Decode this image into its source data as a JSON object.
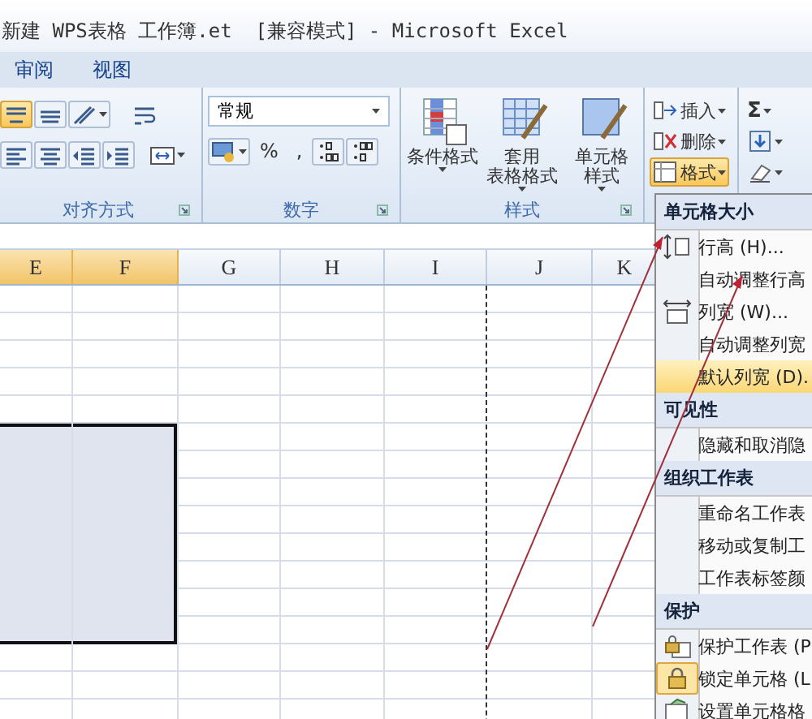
{
  "window": {
    "title": "新建 WPS表格 工作簿.et  [兼容模式] - Microsoft Excel"
  },
  "ribbon_tabs": [
    {
      "label": "审阅",
      "selected": false
    },
    {
      "label": "视图",
      "selected": false
    }
  ],
  "ribbon_groups": [
    {
      "kind": "alignment",
      "label": "对齐方式",
      "buttons": [
        {
          "kind": "top",
          "selected": true
        },
        {
          "kind": "middle",
          "selected": false
        },
        {
          "kind": "orientation",
          "selected": false
        },
        {
          "kind": "wrap",
          "selected": false
        },
        {
          "kind": "left",
          "selected": false
        },
        {
          "kind": "center",
          "selected": false
        },
        {
          "kind": "outdent",
          "selected": false
        },
        {
          "kind": "indent",
          "selected": false
        },
        {
          "kind": "merge",
          "selected": false
        }
      ]
    },
    {
      "kind": "number",
      "label": "数字",
      "format": "常规",
      "buttons": [
        "%",
        ","
      ]
    },
    {
      "kind": "styles",
      "label": "样式",
      "buttons": [
        {
          "kind": "conditional",
          "lines": [
            "条件格式"
          ]
        },
        {
          "kind": "table",
          "lines": [
            "套用",
            "表格格式"
          ]
        },
        {
          "kind": "cellstyle",
          "lines": [
            "单元格",
            "样式"
          ]
        }
      ]
    },
    {
      "kind": "cells",
      "buttons": [
        {
          "kind": "insert",
          "label": "插入",
          "selected": false
        },
        {
          "kind": "delete",
          "label": "删除",
          "selected": false
        },
        {
          "kind": "format",
          "label": "格式",
          "selected": true
        }
      ]
    },
    {
      "kind": "editing",
      "buttons": [
        {
          "kind": "sum",
          "label": "Σ"
        },
        {
          "kind": "fill"
        },
        {
          "kind": "clear"
        }
      ]
    }
  ],
  "sheet": {
    "columns": [
      {
        "label": "E",
        "selected": true,
        "page_break": false
      },
      {
        "label": "F",
        "selected": true,
        "page_break": false
      },
      {
        "label": "G",
        "selected": false,
        "page_break": false
      },
      {
        "label": "H",
        "selected": false,
        "page_break": false
      },
      {
        "label": "I",
        "selected": false,
        "page_break": true
      },
      {
        "label": "J",
        "selected": false,
        "page_break": false
      },
      {
        "label": "K",
        "selected": false,
        "page_break": false
      }
    ]
  },
  "format_menu": {
    "sections": [
      {
        "title": "单元格大小",
        "items": [
          {
            "kind": "rowheight",
            "label": "行高 (H)...",
            "selected": false,
            "checked": false
          },
          {
            "kind": "plain",
            "label": "自动调整行高",
            "selected": false,
            "checked": false
          },
          {
            "kind": "colwidth",
            "label": "列宽 (W)...",
            "selected": false,
            "checked": false
          },
          {
            "kind": "plain",
            "label": "自动调整列宽",
            "selected": false,
            "checked": false
          },
          {
            "kind": "plain",
            "label": "默认列宽 (D).",
            "selected": true,
            "checked": false
          }
        ]
      },
      {
        "title": "可见性",
        "items": [
          {
            "kind": "plain",
            "label": "隐藏和取消隐",
            "selected": false,
            "checked": false
          }
        ]
      },
      {
        "title": "组织工作表",
        "items": [
          {
            "kind": "plain",
            "label": "重命名工作表",
            "selected": false,
            "checked": false
          },
          {
            "kind": "plain",
            "label": "移动或复制工",
            "selected": false,
            "checked": false
          },
          {
            "kind": "plain",
            "label": "工作表标签颜",
            "selected": false,
            "checked": false
          }
        ]
      },
      {
        "title": "保护",
        "items": [
          {
            "kind": "protect",
            "label": "保护工作表 (P",
            "selected": false,
            "checked": false
          },
          {
            "kind": "lock",
            "label": "锁定单元格 (L",
            "selected": false,
            "checked": true
          },
          {
            "kind": "formatcells",
            "label": "设置单元格格",
            "selected": false,
            "checked": false
          }
        ]
      }
    ]
  }
}
